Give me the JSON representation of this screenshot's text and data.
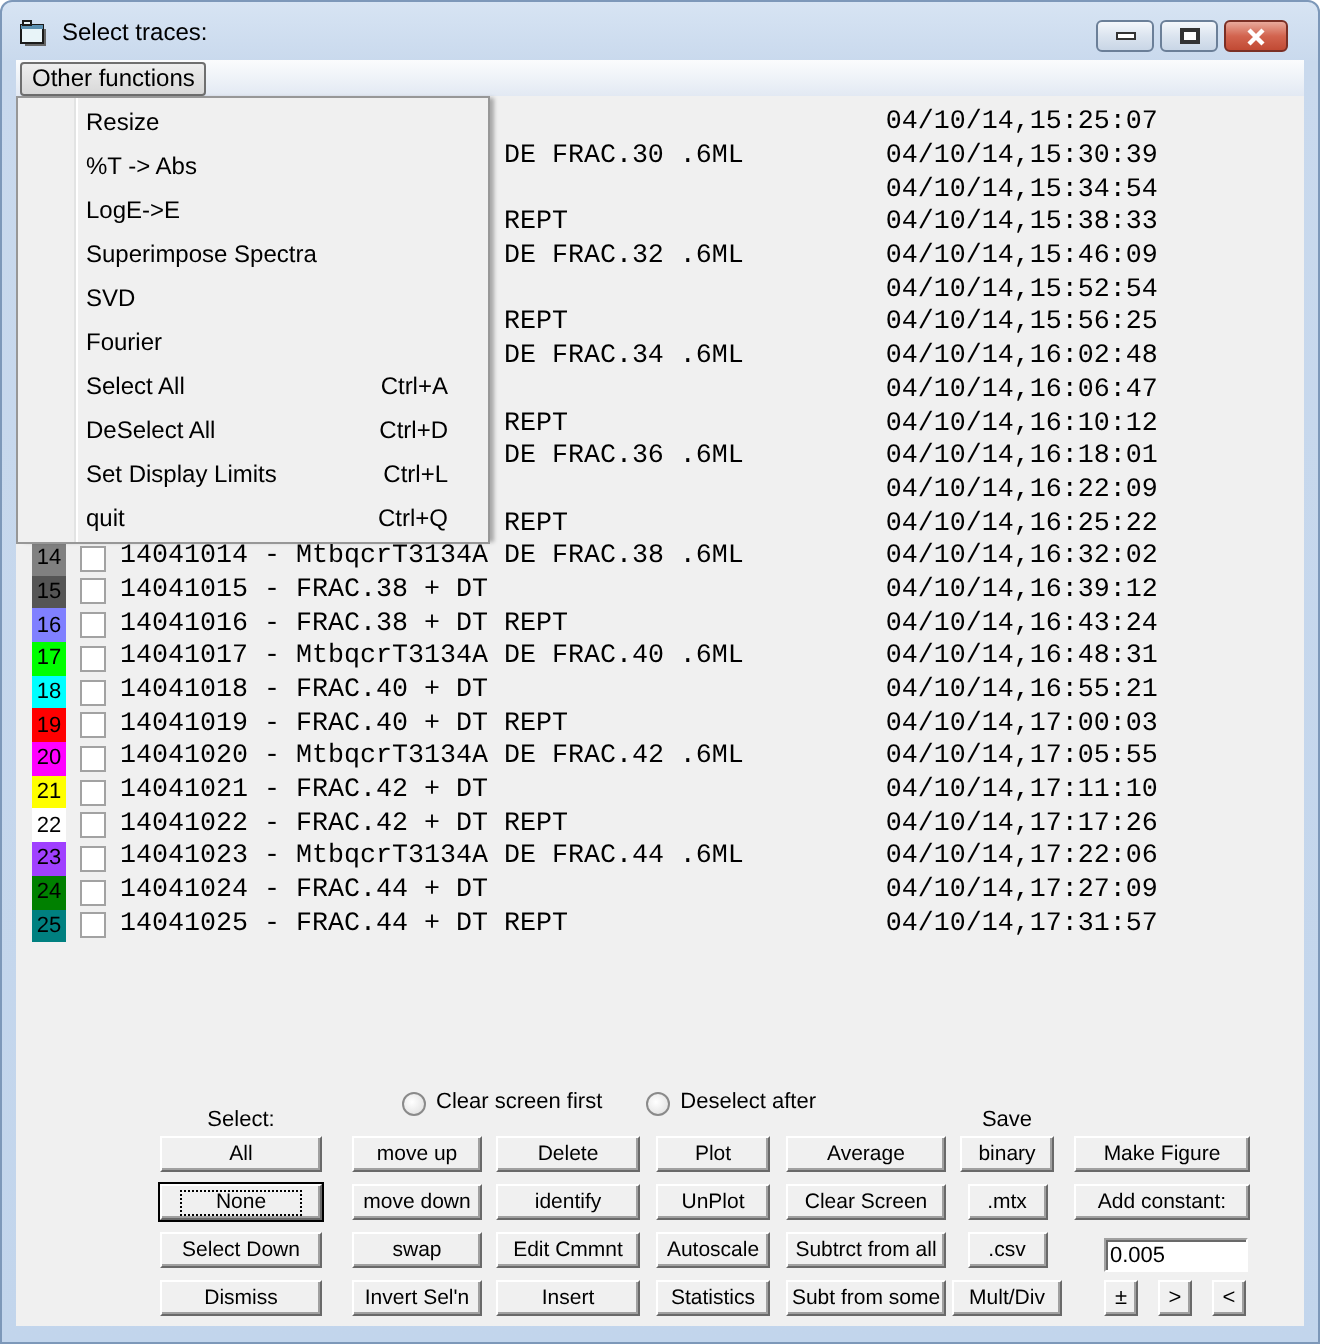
{
  "window": {
    "title": "Select traces:"
  },
  "menu_bar": {
    "items": [
      {
        "label": "Other functions",
        "expanded": true,
        "menu": [
          {
            "label": "Resize"
          },
          {
            "label": "%T -> Abs"
          },
          {
            "label": "LogE->E"
          },
          {
            "label": "Superimpose Spectra"
          },
          {
            "label": "SVD"
          },
          {
            "label": "Fourier"
          },
          {
            "label": "Select All",
            "shortcut": "Ctrl+A"
          },
          {
            "label": "DeSelect All",
            "shortcut": "Ctrl+D"
          },
          {
            "label": "Set Display Limits",
            "shortcut": "Ctrl+L"
          },
          {
            "label": "quit",
            "shortcut": "Ctrl+Q"
          }
        ]
      }
    ]
  },
  "traces": [
    {
      "kind": "covered",
      "time": "04/10/14,15:25:07"
    },
    {
      "kind": "covered",
      "tail": "DE FRAC.30 .6ML",
      "time": "04/10/14,15:30:39"
    },
    {
      "kind": "covered",
      "time": "04/10/14,15:34:54"
    },
    {
      "kind": "covered",
      "tail": "REPT",
      "time": "04/10/14,15:38:33"
    },
    {
      "kind": "covered",
      "tail": "DE FRAC.32 .6ML",
      "time": "04/10/14,15:46:09"
    },
    {
      "kind": "covered",
      "time": "04/10/14,15:52:54"
    },
    {
      "kind": "covered",
      "tail": "REPT",
      "time": "04/10/14,15:56:25"
    },
    {
      "kind": "covered",
      "tail": "DE FRAC.34 .6ML",
      "time": "04/10/14,16:02:48"
    },
    {
      "kind": "covered",
      "time": "04/10/14,16:06:47"
    },
    {
      "kind": "covered",
      "tail": "REPT",
      "time": "04/10/14,16:10:12"
    },
    {
      "kind": "covered",
      "tail": "DE FRAC.36 .6ML",
      "time": "04/10/14,16:18:01"
    },
    {
      "kind": "covered",
      "time": "04/10/14,16:22:09"
    },
    {
      "kind": "covered",
      "tail": "REPT",
      "time": "04/10/14,16:25:22"
    },
    {
      "kind": "trace",
      "number": "14",
      "color": "#808080",
      "checked": false,
      "label": "14041014 - MtbqcrT3134A DE FRAC.38 .6ML",
      "time": "04/10/14,16:32:02"
    },
    {
      "kind": "trace",
      "number": "15",
      "color": "#555555",
      "checked": false,
      "label": "14041015 - FRAC.38 + DT",
      "time": "04/10/14,16:39:12"
    },
    {
      "kind": "trace",
      "number": "16",
      "color": "#8080ff",
      "checked": false,
      "label": "14041016 - FRAC.38 + DT REPT",
      "time": "04/10/14,16:43:24"
    },
    {
      "kind": "trace",
      "number": "17",
      "color": "#00ff00",
      "checked": false,
      "label": "14041017 - MtbqcrT3134A DE FRAC.40 .6ML",
      "time": "04/10/14,16:48:31"
    },
    {
      "kind": "trace",
      "number": "18",
      "color": "#00ffff",
      "checked": false,
      "label": "14041018 - FRAC.40 + DT",
      "time": "04/10/14,16:55:21"
    },
    {
      "kind": "trace",
      "number": "19",
      "color": "#ff0000",
      "checked": false,
      "label": "14041019 - FRAC.40 + DT REPT",
      "time": "04/10/14,17:00:03"
    },
    {
      "kind": "trace",
      "number": "20",
      "color": "#ff00ff",
      "checked": false,
      "label": "14041020 - MtbqcrT3134A DE FRAC.42 .6ML",
      "time": "04/10/14,17:05:55"
    },
    {
      "kind": "trace",
      "number": "21",
      "color": "#ffff00",
      "checked": false,
      "label": "14041021 - FRAC.42 + DT",
      "time": "04/10/14,17:11:10"
    },
    {
      "kind": "trace",
      "number": "22",
      "color": "#ffffff",
      "checked": false,
      "label": "14041022 - FRAC.42 + DT REPT",
      "time": "04/10/14,17:17:26"
    },
    {
      "kind": "trace",
      "number": "23",
      "color": "#a040ff",
      "checked": false,
      "label": "14041023 - MtbqcrT3134A DE FRAC.44 .6ML",
      "time": "04/10/14,17:22:06"
    },
    {
      "kind": "trace",
      "number": "24",
      "color": "#008000",
      "checked": false,
      "label": "14041024 - FRAC.44 + DT",
      "time": "04/10/14,17:27:09"
    },
    {
      "kind": "trace",
      "number": "25",
      "color": "#008080",
      "checked": false,
      "label": "14041025 - FRAC.44 + DT REPT",
      "time": "04/10/14,17:31:57"
    }
  ],
  "controls": {
    "options": [
      {
        "label": "Clear screen first",
        "checked": false
      },
      {
        "label": "Deselect after",
        "checked": false
      }
    ],
    "columns": [
      {
        "heading": "Select:",
        "items": [
          {
            "kind": "button",
            "label": "All",
            "focused": false
          },
          {
            "kind": "button",
            "label": "None",
            "focused": true
          },
          {
            "kind": "button",
            "label": "Select Down",
            "focused": false
          },
          {
            "kind": "button",
            "label": "Dismiss",
            "focused": false
          }
        ]
      },
      {
        "items": [
          {
            "kind": "button",
            "label": "move up",
            "focused": false
          },
          {
            "kind": "button",
            "label": "move down",
            "focused": false
          },
          {
            "kind": "button",
            "label": "swap",
            "focused": false
          },
          {
            "kind": "button",
            "label": "Invert Sel'n",
            "focused": false
          }
        ]
      },
      {
        "items": [
          {
            "kind": "button",
            "label": "Delete",
            "focused": false
          },
          {
            "kind": "button",
            "label": "identify",
            "focused": false
          },
          {
            "kind": "button",
            "label": "Edit Cmmnt",
            "focused": false
          },
          {
            "kind": "button",
            "label": "Insert",
            "focused": false
          }
        ]
      },
      {
        "items": [
          {
            "kind": "button",
            "label": "Plot",
            "focused": false
          },
          {
            "kind": "button",
            "label": "UnPlot",
            "focused": false
          },
          {
            "kind": "button",
            "label": "Autoscale",
            "focused": false
          },
          {
            "kind": "button",
            "label": "Statistics",
            "focused": false
          }
        ]
      },
      {
        "items": [
          {
            "kind": "button",
            "label": "Average",
            "focused": false
          },
          {
            "kind": "button",
            "label": "Clear Screen",
            "focused": false
          },
          {
            "kind": "button",
            "label": "Subtrct from all",
            "focused": false
          },
          {
            "kind": "button",
            "label": "Subt from some",
            "focused": false
          }
        ]
      },
      {
        "heading": "Save",
        "items": [
          {
            "kind": "button",
            "label": "binary",
            "focused": false
          },
          {
            "kind": "button",
            "label": ".mtx",
            "focused": false
          },
          {
            "kind": "button",
            "label": ".csv",
            "focused": false
          },
          {
            "kind": "button",
            "label": "Mult/Div",
            "focused": false
          }
        ]
      },
      {
        "items": [
          {
            "kind": "button",
            "label": "Make Figure",
            "focused": false
          },
          {
            "kind": "button",
            "label": "Add constant:",
            "focused": false
          },
          {
            "kind": "field",
            "value": "0.005"
          },
          {
            "kind": "button_row",
            "buttons": [
              {
                "label": "±",
                "focused": false
              },
              {
                "label": ">",
                "focused": false
              },
              {
                "label": "<",
                "focused": false
              }
            ]
          }
        ]
      }
    ]
  }
}
